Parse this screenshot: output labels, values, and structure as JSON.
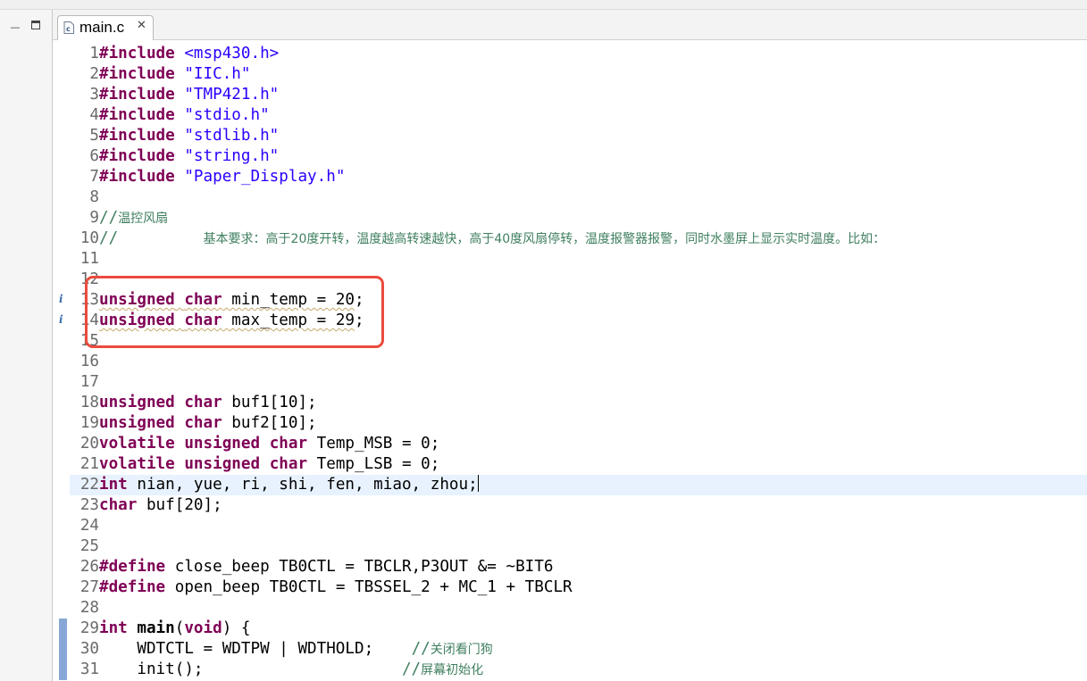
{
  "editor": {
    "tab": {
      "filename": "main.c",
      "close_glyph": "✕"
    },
    "info_marker_glyph": "i",
    "lines": [
      {
        "n": "1",
        "parts": [
          {
            "t": "#include",
            "c": "kw"
          },
          {
            "t": " "
          },
          {
            "t": "<msp430.h>",
            "c": "str"
          }
        ]
      },
      {
        "n": "2",
        "parts": [
          {
            "t": "#include",
            "c": "kw"
          },
          {
            "t": " "
          },
          {
            "t": "\"IIC.h\"",
            "c": "str"
          }
        ]
      },
      {
        "n": "3",
        "parts": [
          {
            "t": "#include",
            "c": "kw"
          },
          {
            "t": " "
          },
          {
            "t": "\"TMP421.h\"",
            "c": "str"
          }
        ]
      },
      {
        "n": "4",
        "parts": [
          {
            "t": "#include",
            "c": "kw"
          },
          {
            "t": " "
          },
          {
            "t": "\"stdio.h\"",
            "c": "str"
          }
        ]
      },
      {
        "n": "5",
        "parts": [
          {
            "t": "#include",
            "c": "kw"
          },
          {
            "t": " "
          },
          {
            "t": "\"stdlib.h\"",
            "c": "str"
          }
        ]
      },
      {
        "n": "6",
        "parts": [
          {
            "t": "#include",
            "c": "kw"
          },
          {
            "t": " "
          },
          {
            "t": "\"string.h\"",
            "c": "str"
          }
        ]
      },
      {
        "n": "7",
        "parts": [
          {
            "t": "#include",
            "c": "kw"
          },
          {
            "t": " "
          },
          {
            "t": "\"Paper_Display.h\"",
            "c": "str"
          }
        ]
      },
      {
        "n": "8",
        "parts": []
      },
      {
        "n": "9",
        "parts": [
          {
            "t": "//",
            "c": "cm"
          },
          {
            "t": "温控风扇",
            "c": "cmcn"
          }
        ]
      },
      {
        "n": "10",
        "parts": [
          {
            "t": "//         ",
            "c": "cm"
          },
          {
            "t": "基本要求：高于20度开转，温度越高转速越快，高于40度风扇停转，温度报警器报警，同时水墨屏上显示实时温度。比如：",
            "c": "cmcn"
          }
        ]
      },
      {
        "n": "11",
        "parts": []
      },
      {
        "n": "12",
        "parts": []
      },
      {
        "n": "13",
        "info": true,
        "parts": [
          {
            "t": "unsigned",
            "c": "kw squig"
          },
          {
            "t": " ",
            "c": "squig"
          },
          {
            "t": "char",
            "c": "kw squig"
          },
          {
            "t": " min_temp = 20",
            "c": "squig"
          },
          {
            "t": ";"
          }
        ]
      },
      {
        "n": "14",
        "info": true,
        "parts": [
          {
            "t": "unsigned",
            "c": "kw squig"
          },
          {
            "t": " ",
            "c": "squig"
          },
          {
            "t": "char",
            "c": "kw squig"
          },
          {
            "t": " max_temp = 29",
            "c": "squig"
          },
          {
            "t": ";"
          }
        ]
      },
      {
        "n": "15",
        "parts": []
      },
      {
        "n": "16",
        "parts": []
      },
      {
        "n": "17",
        "parts": []
      },
      {
        "n": "18",
        "parts": [
          {
            "t": "unsigned",
            "c": "kw"
          },
          {
            "t": " "
          },
          {
            "t": "char",
            "c": "kw"
          },
          {
            "t": " buf1[10];"
          }
        ]
      },
      {
        "n": "19",
        "parts": [
          {
            "t": "unsigned",
            "c": "kw"
          },
          {
            "t": " "
          },
          {
            "t": "char",
            "c": "kw"
          },
          {
            "t": " buf2[10];"
          }
        ]
      },
      {
        "n": "20",
        "parts": [
          {
            "t": "volatile",
            "c": "kw"
          },
          {
            "t": " "
          },
          {
            "t": "unsigned",
            "c": "kw"
          },
          {
            "t": " "
          },
          {
            "t": "char",
            "c": "kw"
          },
          {
            "t": " Temp_MSB = 0;"
          }
        ]
      },
      {
        "n": "21",
        "parts": [
          {
            "t": "volatile",
            "c": "kw"
          },
          {
            "t": " "
          },
          {
            "t": "unsigned",
            "c": "kw"
          },
          {
            "t": " "
          },
          {
            "t": "char",
            "c": "kw"
          },
          {
            "t": " Temp_LSB = 0;"
          }
        ]
      },
      {
        "n": "22",
        "current": true,
        "parts": [
          {
            "t": "int",
            "c": "kw"
          },
          {
            "t": " nian, yue, ri, shi, fen, miao, zhou;"
          }
        ]
      },
      {
        "n": "23",
        "parts": [
          {
            "t": "char",
            "c": "kw"
          },
          {
            "t": " buf[20];"
          }
        ]
      },
      {
        "n": "24",
        "parts": []
      },
      {
        "n": "25",
        "parts": []
      },
      {
        "n": "26",
        "parts": [
          {
            "t": "#define",
            "c": "kw"
          },
          {
            "t": " close_beep TB0CTL = TBCLR,P3OUT &= ~BIT6"
          }
        ]
      },
      {
        "n": "27",
        "parts": [
          {
            "t": "#define",
            "c": "kw"
          },
          {
            "t": " open_beep TB0CTL = TBSSEL_2 + MC_1 + TBCLR"
          }
        ]
      },
      {
        "n": "28",
        "parts": []
      },
      {
        "n": "29",
        "change": true,
        "parts": [
          {
            "t": "int",
            "c": "kw"
          },
          {
            "t": " "
          },
          {
            "t": "main",
            "c": "kwb"
          },
          {
            "t": "("
          },
          {
            "t": "void",
            "c": "kw"
          },
          {
            "t": ") {"
          }
        ]
      },
      {
        "n": "30",
        "change": true,
        "parts": [
          {
            "t": "    WDTCTL = WDTPW | WDTHOLD;    "
          },
          {
            "t": "//",
            "c": "cm"
          },
          {
            "t": "关闭看门狗",
            "c": "cmcn"
          }
        ]
      },
      {
        "n": "31",
        "change": true,
        "parts": [
          {
            "t": "    init();                     "
          },
          {
            "t": "//",
            "c": "cm"
          },
          {
            "t": "屏幕初始化",
            "c": "cmcn"
          }
        ]
      }
    ]
  }
}
